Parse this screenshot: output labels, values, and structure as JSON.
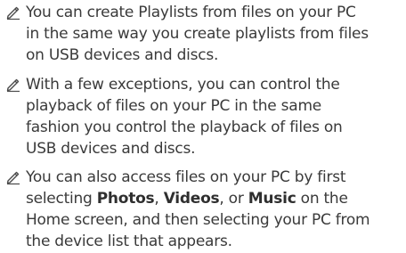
{
  "notes": [
    {
      "icon": "note-pencil-icon",
      "lines": [
        "You can create Playlists from files on your PC",
        "in the same way you create playlists from files",
        "on USB devices and discs."
      ]
    },
    {
      "icon": "note-pencil-icon",
      "lines": [
        "With a few exceptions, you can control the",
        "playback of files on your PC in the same",
        "fashion you control the playback of files on",
        "USB devices and discs."
      ]
    },
    {
      "icon": "note-pencil-icon",
      "line1": "You can also access files on your PC by first",
      "line2": {
        "pre": "selecting ",
        "photos": "Photos",
        "sep1": ", ",
        "videos": "Videos",
        "sep2": ", or ",
        "music": "Music",
        "post": " on the"
      },
      "line3": "Home screen, and then selecting your PC from",
      "line4": "the device list that appears."
    }
  ]
}
